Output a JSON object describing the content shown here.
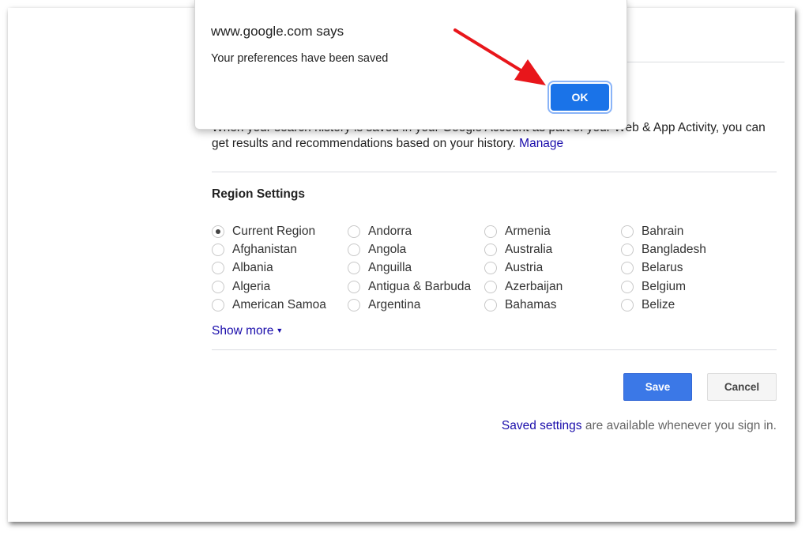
{
  "dialog": {
    "title": "www.google.com says",
    "message": "Your preferences have been saved",
    "ok_label": "OK"
  },
  "history": {
    "text": "When your search history is saved in your Google Account as part of your Web & App Activity, you can get results and recommendations based on your history.",
    "manage_link": "Manage"
  },
  "region_settings": {
    "title": "Region Settings",
    "selected": "Current Region",
    "options": [
      "Current Region",
      "Andorra",
      "Armenia",
      "Bahrain",
      "Afghanistan",
      "Angola",
      "Australia",
      "Bangladesh",
      "Albania",
      "Anguilla",
      "Austria",
      "Belarus",
      "Algeria",
      "Antigua & Barbuda",
      "Azerbaijan",
      "Belgium",
      "American Samoa",
      "Argentina",
      "Bahamas",
      "Belize"
    ],
    "show_more": "Show more"
  },
  "buttons": {
    "save": "Save",
    "cancel": "Cancel"
  },
  "footer": {
    "saved_settings_link": "Saved settings",
    "note": " are available whenever you sign in."
  },
  "colors": {
    "accent": "#1a73e8",
    "save_button": "#3b78e7",
    "link": "#1a0dab",
    "annotation_arrow": "#e8161b"
  },
  "icons": {
    "annotation": "red-arrow-icon",
    "more": "caret-down-icon"
  }
}
